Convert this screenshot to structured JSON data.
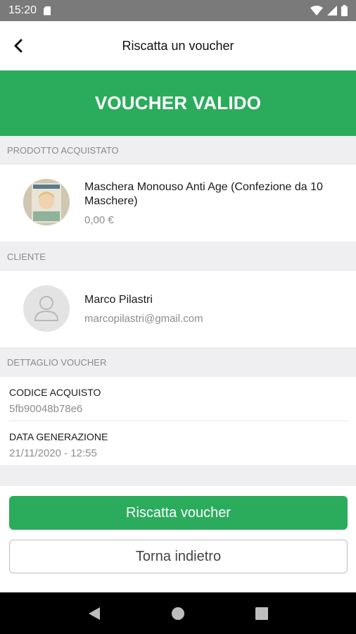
{
  "status_bar": {
    "time": "15:20"
  },
  "app_bar": {
    "title": "Riscatta un voucher"
  },
  "banner": {
    "text": "VOUCHER VALIDO"
  },
  "product_section": {
    "header": "PRODOTTO ACQUISTATO",
    "name": "Maschera Monouso Anti Age (Confezione da 10 Maschere)",
    "price": "0,00 €"
  },
  "customer_section": {
    "header": "CLIENTE",
    "name": "Marco Pilastri",
    "email": "marcopilastri@gmail.com"
  },
  "voucher_section": {
    "header": "DETTAGLIO VOUCHER",
    "code_label": "CODICE ACQUISTO",
    "code_value": "5fb90048b78e6",
    "date_label": "DATA GENERAZIONE",
    "date_value": "21/11/2020 - 12:55"
  },
  "actions": {
    "redeem_label": "Riscatta voucher",
    "back_label": "Torna indietro"
  },
  "colors": {
    "accent": "#2bac5c",
    "status_bar": "#7a7a7a"
  }
}
